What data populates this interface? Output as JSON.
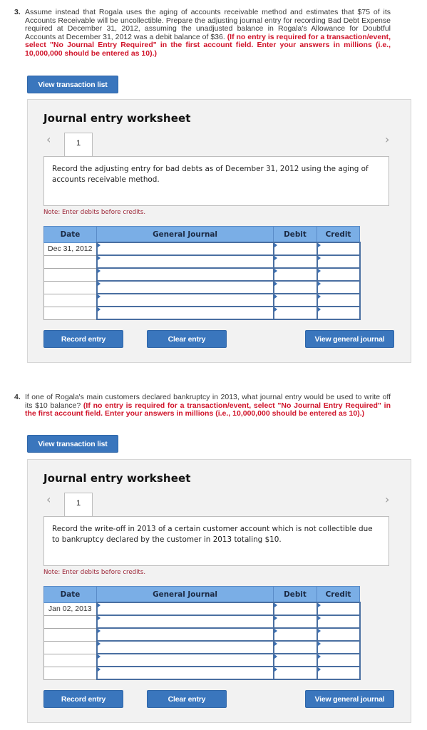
{
  "questions": [
    {
      "number": "3.",
      "text": "Assume instead that Rogala uses the aging of accounts receivable method and estimates that $75 of its Accounts Receivable will be uncollectible. Prepare the adjusting journal entry for recording Bad Debt Expense required at December 31, 2012, assuming the unadjusted balance in Rogala's Allowance for Doubtful Accounts at December 31, 2012 was a debit balance of $36.",
      "instruction": "(If no entry is required for a transaction/event, select \"No Journal Entry Required\" in the first account field. Enter your answers in millions (i.e., 10,000,000 should be entered as 10).)",
      "view_transaction_list_label": "View transaction list",
      "worksheet": {
        "title": "Journal entry worksheet",
        "prev_icon": "‹",
        "next_icon": "›",
        "active_tab": "1",
        "prompt": "Record the adjusting entry for bad debts as of December 31, 2012 using the aging of accounts receivable method.",
        "note": "Note: Enter debits before credits.",
        "columns": [
          "Date",
          "General Journal",
          "Debit",
          "Credit"
        ],
        "rows": [
          {
            "date": "Dec 31, 2012",
            "account": "",
            "debit": "",
            "credit": ""
          },
          {
            "date": "",
            "account": "",
            "debit": "",
            "credit": ""
          },
          {
            "date": "",
            "account": "",
            "debit": "",
            "credit": ""
          },
          {
            "date": "",
            "account": "",
            "debit": "",
            "credit": ""
          },
          {
            "date": "",
            "account": "",
            "debit": "",
            "credit": ""
          },
          {
            "date": "",
            "account": "",
            "debit": "",
            "credit": ""
          }
        ],
        "record_label": "Record entry",
        "clear_label": "Clear entry",
        "view_journal_label": "View general journal"
      }
    },
    {
      "number": "4.",
      "text": "If one of Rogala's main customers declared bankruptcy in 2013, what journal entry would be used to write off its $10 balance?",
      "instruction": "(If no entry is required for a transaction/event, select \"No Journal Entry Required\" in the first account field. Enter your answers in millions (i.e., 10,000,000 should be entered as 10).)",
      "view_transaction_list_label": "View transaction list",
      "worksheet": {
        "title": "Journal entry worksheet",
        "prev_icon": "‹",
        "next_icon": "›",
        "active_tab": "1",
        "prompt": "Record the write-off in 2013 of a certain customer account which is not collectible due to bankruptcy declared by the customer in 2013 totaling $10.",
        "note": "Note: Enter debits before credits.",
        "columns": [
          "Date",
          "General Journal",
          "Debit",
          "Credit"
        ],
        "rows": [
          {
            "date": "Jan 02, 2013",
            "account": "",
            "debit": "",
            "credit": ""
          },
          {
            "date": "",
            "account": "",
            "debit": "",
            "credit": ""
          },
          {
            "date": "",
            "account": "",
            "debit": "",
            "credit": ""
          },
          {
            "date": "",
            "account": "",
            "debit": "",
            "credit": ""
          },
          {
            "date": "",
            "account": "",
            "debit": "",
            "credit": ""
          },
          {
            "date": "",
            "account": "",
            "debit": "",
            "credit": ""
          }
        ],
        "record_label": "Record entry",
        "clear_label": "Clear entry",
        "view_journal_label": "View general journal"
      }
    }
  ]
}
